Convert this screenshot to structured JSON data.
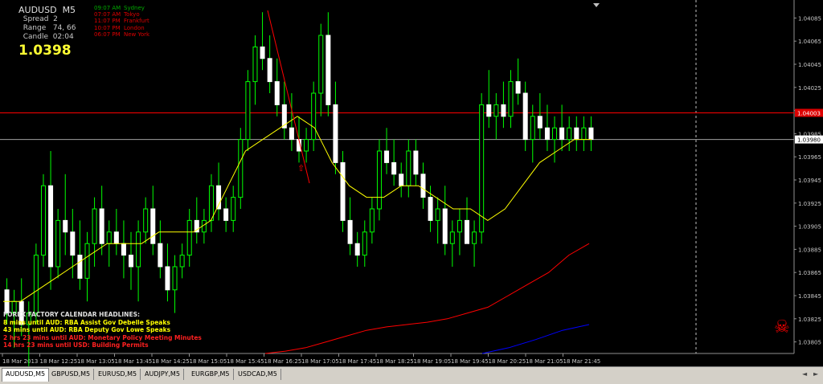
{
  "symbol": "AUDUSD",
  "timeframe": "M5",
  "info": {
    "spread_label": "Spread",
    "spread_value": "2",
    "range_label": "Range",
    "range_value": "74, 66",
    "candle_label": "Candle",
    "candle_value": "02:04",
    "bid": "1.0398"
  },
  "sessions": [
    {
      "time": "09:07 AM",
      "name": "Sydney",
      "color": "#00aa00"
    },
    {
      "time": "07:07 AM",
      "name": "Tokyo",
      "color": "#dd0000"
    },
    {
      "time": "11:07 PM",
      "name": "Frankfurt",
      "color": "#dd0000"
    },
    {
      "time": "10:07 PM",
      "name": "London",
      "color": "#dd0000"
    },
    {
      "time": "06:07 PM",
      "name": "New York",
      "color": "#dd0000"
    }
  ],
  "news": {
    "header": "FOREX FACTORY CALENDAR HEADLINES:",
    "items": [
      {
        "text": "8 mins until AUD: RBA Assist Gov Debelle Speaks",
        "color": "#ffff00"
      },
      {
        "text": "43 mins until AUD: RBA Deputy Gov Lowe Speaks",
        "color": "#ffff00"
      },
      {
        "text": "2 hrs 23 mins until AUD: Monetary Policy Meeting Minutes",
        "color": "#ff2020"
      },
      {
        "text": "14 hrs 23 mins until USD: Building Permits",
        "color": "#ff2020"
      }
    ]
  },
  "price_axis": {
    "labels": [
      "1.04085",
      "1.04065",
      "1.04045",
      "1.04025",
      "1.04005",
      "1.03985",
      "1.03965",
      "1.03945",
      "1.03925",
      "1.03905",
      "1.03885",
      "1.03865",
      "1.03845",
      "1.03825",
      "1.03805"
    ],
    "red_line_label": "1.04003",
    "current_label": "1.03980"
  },
  "time_axis": [
    "18 Mar 2013",
    "18 Mar 12:25",
    "18 Mar 13:05",
    "18 Mar 13:45",
    "18 Mar 14:25",
    "18 Mar 15:05",
    "18 Mar 15:45",
    "18 Mar 16:25",
    "18 Mar 17:05",
    "18 Mar 17:45",
    "18 Mar 18:25",
    "18 Mar 19:05",
    "18 Mar 19:45",
    "18 Mar 20:25",
    "18 Mar 21:05",
    "18 Mar 21:45"
  ],
  "colors": {
    "candle": "#00ff00",
    "ma": "#ffff00",
    "ma_slow": "#ff0000",
    "ma_slowest": "#0000ff",
    "resistance": "#ff0000",
    "current_price": "#a0a0a0",
    "trendline": "#ff0000"
  },
  "tabs": [
    {
      "label": "AUDUSD,M5",
      "active": true
    },
    {
      "label": "GBPUSD,M5",
      "active": false
    },
    {
      "label": "EURUSD,M5",
      "active": false
    },
    {
      "label": "AUDJPY,M5",
      "active": false
    },
    {
      "label": "EURGBP,M5",
      "active": false
    },
    {
      "label": "USDCAD,M5",
      "active": false
    }
  ],
  "chart_data": {
    "type": "candlestick",
    "ylim": [
      1.03795,
      1.04095
    ],
    "resistance": 1.04003,
    "current": 1.0398,
    "candles": [
      [
        1.0385,
        1.0386,
        1.0382,
        1.0383
      ],
      [
        1.0383,
        1.0385,
        1.038,
        1.0384
      ],
      [
        1.0384,
        1.0386,
        1.0381,
        1.0382
      ],
      [
        1.0382,
        1.0384,
        1.0378,
        1.0383
      ],
      [
        1.0383,
        1.0389,
        1.0382,
        1.0388
      ],
      [
        1.0388,
        1.0395,
        1.0387,
        1.0394
      ],
      [
        1.0394,
        1.0397,
        1.0385,
        1.0387
      ],
      [
        1.0387,
        1.0392,
        1.0386,
        1.0391
      ],
      [
        1.0391,
        1.0395,
        1.0388,
        1.039
      ],
      [
        1.039,
        1.0392,
        1.0386,
        1.0388
      ],
      [
        1.0388,
        1.0391,
        1.0385,
        1.0386
      ],
      [
        1.0386,
        1.039,
        1.0384,
        1.0389
      ],
      [
        1.0389,
        1.0393,
        1.0387,
        1.0392
      ],
      [
        1.0392,
        1.0394,
        1.0388,
        1.0389
      ],
      [
        1.0389,
        1.0391,
        1.0387,
        1.039
      ],
      [
        1.039,
        1.0392,
        1.0388,
        1.0389
      ],
      [
        1.0389,
        1.0391,
        1.0386,
        1.0388
      ],
      [
        1.0388,
        1.039,
        1.0385,
        1.0387
      ],
      [
        1.0387,
        1.0391,
        1.0384,
        1.039
      ],
      [
        1.039,
        1.0393,
        1.0389,
        1.0392
      ],
      [
        1.0392,
        1.0394,
        1.0388,
        1.0389
      ],
      [
        1.0389,
        1.0391,
        1.0386,
        1.0387
      ],
      [
        1.0387,
        1.0389,
        1.0384,
        1.0385
      ],
      [
        1.0385,
        1.0388,
        1.0383,
        1.0387
      ],
      [
        1.0387,
        1.0389,
        1.0386,
        1.0388
      ],
      [
        1.0388,
        1.0392,
        1.0387,
        1.0391
      ],
      [
        1.0391,
        1.0393,
        1.0389,
        1.039
      ],
      [
        1.039,
        1.0392,
        1.0389,
        1.0391
      ],
      [
        1.0391,
        1.0395,
        1.039,
        1.0394
      ],
      [
        1.0394,
        1.0396,
        1.0391,
        1.0392
      ],
      [
        1.0392,
        1.0393,
        1.039,
        1.0391
      ],
      [
        1.0391,
        1.0394,
        1.039,
        1.0393
      ],
      [
        1.0393,
        1.0399,
        1.0392,
        1.0398
      ],
      [
        1.0398,
        1.0404,
        1.0397,
        1.0403
      ],
      [
        1.0403,
        1.0407,
        1.0401,
        1.0406
      ],
      [
        1.0406,
        1.0409,
        1.0404,
        1.0405
      ],
      [
        1.0405,
        1.0407,
        1.0402,
        1.0403
      ],
      [
        1.0403,
        1.0405,
        1.04,
        1.0401
      ],
      [
        1.0401,
        1.0403,
        1.0398,
        1.0399
      ],
      [
        1.0399,
        1.0402,
        1.0397,
        1.0398
      ],
      [
        1.0398,
        1.04,
        1.0396,
        1.0397
      ],
      [
        1.0397,
        1.0399,
        1.0396,
        1.0398
      ],
      [
        1.0398,
        1.0403,
        1.0397,
        1.0402
      ],
      [
        1.0402,
        1.0408,
        1.04,
        1.0407
      ],
      [
        1.0407,
        1.0409,
        1.04,
        1.0401
      ],
      [
        1.0401,
        1.0403,
        1.0395,
        1.0396
      ],
      [
        1.0396,
        1.0397,
        1.039,
        1.0391
      ],
      [
        1.0391,
        1.0393,
        1.0388,
        1.0389
      ],
      [
        1.0389,
        1.039,
        1.0387,
        1.0388
      ],
      [
        1.0388,
        1.0391,
        1.0387,
        1.039
      ],
      [
        1.039,
        1.0393,
        1.0389,
        1.0392
      ],
      [
        1.0392,
        1.0398,
        1.0391,
        1.0397
      ],
      [
        1.0397,
        1.0399,
        1.0395,
        1.0396
      ],
      [
        1.0396,
        1.0398,
        1.0394,
        1.0395
      ],
      [
        1.0395,
        1.0396,
        1.0393,
        1.0394
      ],
      [
        1.0394,
        1.0398,
        1.0393,
        1.0397
      ],
      [
        1.0397,
        1.0398,
        1.0394,
        1.0395
      ],
      [
        1.0395,
        1.0396,
        1.0392,
        1.0393
      ],
      [
        1.0393,
        1.0394,
        1.039,
        1.0391
      ],
      [
        1.0391,
        1.0393,
        1.0389,
        1.0392
      ],
      [
        1.0392,
        1.0394,
        1.0388,
        1.0389
      ],
      [
        1.0389,
        1.0391,
        1.0387,
        1.039
      ],
      [
        1.039,
        1.0392,
        1.0388,
        1.0391
      ],
      [
        1.0391,
        1.0393,
        1.0389,
        1.0389
      ],
      [
        1.0389,
        1.0391,
        1.0387,
        1.039
      ],
      [
        1.039,
        1.0402,
        1.0389,
        1.0401
      ],
      [
        1.0401,
        1.0404,
        1.0399,
        1.04
      ],
      [
        1.04,
        1.0402,
        1.0398,
        1.0401
      ],
      [
        1.0401,
        1.0403,
        1.0399,
        1.04
      ],
      [
        1.04,
        1.0404,
        1.0399,
        1.0403
      ],
      [
        1.0403,
        1.0405,
        1.0401,
        1.0402
      ],
      [
        1.0402,
        1.0403,
        1.0397,
        1.0398
      ],
      [
        1.0398,
        1.0401,
        1.0396,
        1.04
      ],
      [
        1.04,
        1.0402,
        1.0398,
        1.0399
      ],
      [
        1.0399,
        1.0401,
        1.0397,
        1.0398
      ],
      [
        1.0398,
        1.04,
        1.0396,
        1.0399
      ],
      [
        1.0399,
        1.0401,
        1.0397,
        1.0398
      ],
      [
        1.0398,
        1.04,
        1.0397,
        1.0399
      ],
      [
        1.0399,
        1.04,
        1.0397,
        1.0398
      ],
      [
        1.0398,
        1.04,
        1.0397,
        1.0399
      ],
      [
        1.0399,
        1.04,
        1.0397,
        1.0398
      ]
    ],
    "ma_fast": [
      1.0384,
      1.0384,
      1.0385,
      1.0386,
      1.0387,
      1.0388,
      1.0389,
      1.0389,
      1.0389,
      1.039,
      1.039,
      1.039,
      1.0391,
      1.0394,
      1.0397,
      1.0398,
      1.0399,
      1.04,
      1.0399,
      1.0396,
      1.0394,
      1.0393,
      1.0393,
      1.0394,
      1.0394,
      1.0393,
      1.0392,
      1.0392,
      1.0391,
      1.0392,
      1.0394,
      1.0396,
      1.0397,
      1.0398,
      1.0398
    ],
    "ma_slow": [
      1.03795,
      1.03797,
      1.038,
      1.03805,
      1.0381,
      1.03815,
      1.03818,
      1.0382,
      1.03822,
      1.03825,
      1.0383,
      1.03835,
      1.03845,
      1.03855,
      1.03865,
      1.0388,
      1.0389
    ],
    "ma_slowest": [
      1.03795,
      1.038,
      1.03807,
      1.03815,
      1.0382
    ]
  }
}
